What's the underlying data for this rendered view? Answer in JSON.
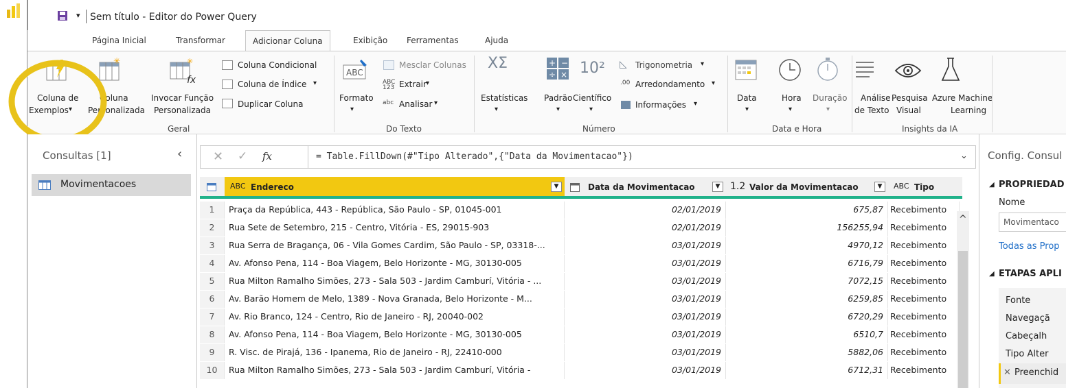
{
  "window": {
    "title": "Sem título - Editor do Power Query"
  },
  "tabs": [
    {
      "label": "Página Inicial"
    },
    {
      "label": "Transformar"
    },
    {
      "label": "Adicionar Coluna"
    },
    {
      "label": "Exibição"
    },
    {
      "label": "Ferramentas"
    },
    {
      "label": "Ajuda"
    }
  ],
  "ribbon": {
    "col_exemplos_1": "Coluna de",
    "col_exemplos_2": "Exemplos",
    "col_pers_1": "Coluna",
    "col_pers_2": "Personalizada",
    "invocar_1": "Invocar Função",
    "invocar_2": "Personalizada",
    "condicional": "Coluna Condicional",
    "indice": "Coluna de Índice",
    "duplicar": "Duplicar Coluna",
    "group_geral": "Geral",
    "formato": "Formato",
    "mesclar": "Mesclar Colunas",
    "extrair": "Extrair",
    "analisar": "Analisar",
    "group_texto": "Do Texto",
    "estatisticas": "Estatísticas",
    "padrao": "Padrão",
    "cientifico": "Científico",
    "trigonometria": "Trigonometria",
    "arredondamento": "Arredondamento",
    "informacoes": "Informações",
    "group_numero": "Número",
    "data": "Data",
    "hora": "Hora",
    "duracao": "Duração",
    "group_datahora": "Data e Hora",
    "analise_1": "Análise",
    "analise_2": "de Texto",
    "pesquisa_1": "Pesquisa",
    "pesquisa_2": "Visual",
    "azure_1": "Azure Machine",
    "azure_2": "Learning",
    "group_ia": "Insights da IA"
  },
  "queries": {
    "header": "Consultas [1]",
    "items": [
      {
        "label": "Movimentacoes"
      }
    ]
  },
  "formula": {
    "fx": "fx",
    "text": "= Table.FillDown(#\"Tipo Alterado\",{\"Data da Movimentacao\"})"
  },
  "table": {
    "columns": [
      {
        "type": "ABC",
        "name": "Endereco"
      },
      {
        "type": "cal",
        "name": "Data da Movimentacao"
      },
      {
        "type": "1.2",
        "name": "Valor da Movimentacao"
      },
      {
        "type": "ABC",
        "name": "Tipo"
      }
    ],
    "rows": [
      {
        "n": "1",
        "end": "Praça da República, 443 - República, São Paulo - SP, 01045-001",
        "data": "02/01/2019",
        "valor": "675,87",
        "tipo": "Recebimento"
      },
      {
        "n": "2",
        "end": "Rua Sete de Setembro, 215 - Centro, Vitória - ES, 29015-903",
        "data": "02/01/2019",
        "valor": "156255,94",
        "tipo": "Recebimento"
      },
      {
        "n": "3",
        "end": "Rua Serra de Bragança, 06 - Vila Gomes Cardim, São Paulo - SP, 03318-...",
        "data": "03/01/2019",
        "valor": "4970,12",
        "tipo": "Recebimento"
      },
      {
        "n": "4",
        "end": "Av. Afonso Pena, 114 - Boa Viagem, Belo Horizonte - MG, 30130-005",
        "data": "03/01/2019",
        "valor": "6716,79",
        "tipo": "Recebimento"
      },
      {
        "n": "5",
        "end": "Rua Milton Ramalho Simões, 273 - Sala 503 - Jardim Camburí, Vitória - ...",
        "data": "03/01/2019",
        "valor": "7072,15",
        "tipo": "Recebimento"
      },
      {
        "n": "6",
        "end": "Av. Barão Homem de Melo, 1389 - Nova Granada, Belo Horizonte - M...",
        "data": "03/01/2019",
        "valor": "6259,85",
        "tipo": "Recebimento"
      },
      {
        "n": "7",
        "end": "Av. Rio Branco, 124 - Centro, Rio de Janeiro - RJ, 20040-002",
        "data": "03/01/2019",
        "valor": "6720,29",
        "tipo": "Recebimento"
      },
      {
        "n": "8",
        "end": "Av. Afonso Pena, 114 - Boa Viagem, Belo Horizonte - MG, 30130-005",
        "data": "03/01/2019",
        "valor": "6510,7",
        "tipo": "Recebimento"
      },
      {
        "n": "9",
        "end": "R. Visc. de Pirajá, 136 - Ipanema, Rio de Janeiro - RJ, 22410-000",
        "data": "03/01/2019",
        "valor": "5882,06",
        "tipo": "Recebimento"
      },
      {
        "n": "10",
        "end": "Rua Milton Ramalho Simões, 273 - Sala 503 - Jardim Camburí, Vitória -",
        "data": "03/01/2019",
        "valor": "6712,31",
        "tipo": "Recebimento"
      }
    ]
  },
  "right_panel": {
    "title": "Config. Consul",
    "propriedades": "PROPRIEDAD",
    "nome_label": "Nome",
    "nome_value": "Movimentaco",
    "todas": "Todas as Prop",
    "etapas": "ETAPAS APLI",
    "steps": [
      {
        "label": "Fonte"
      },
      {
        "label": "Navegaçã"
      },
      {
        "label": "Cabeçalh"
      },
      {
        "label": "Tipo Alter"
      },
      {
        "label": "Preenchid"
      }
    ]
  },
  "colors": {
    "accent": "#f2c811",
    "circle": "#e8c21a",
    "green_bar": "#20b28a",
    "file_tab": "#1e6ec8"
  }
}
